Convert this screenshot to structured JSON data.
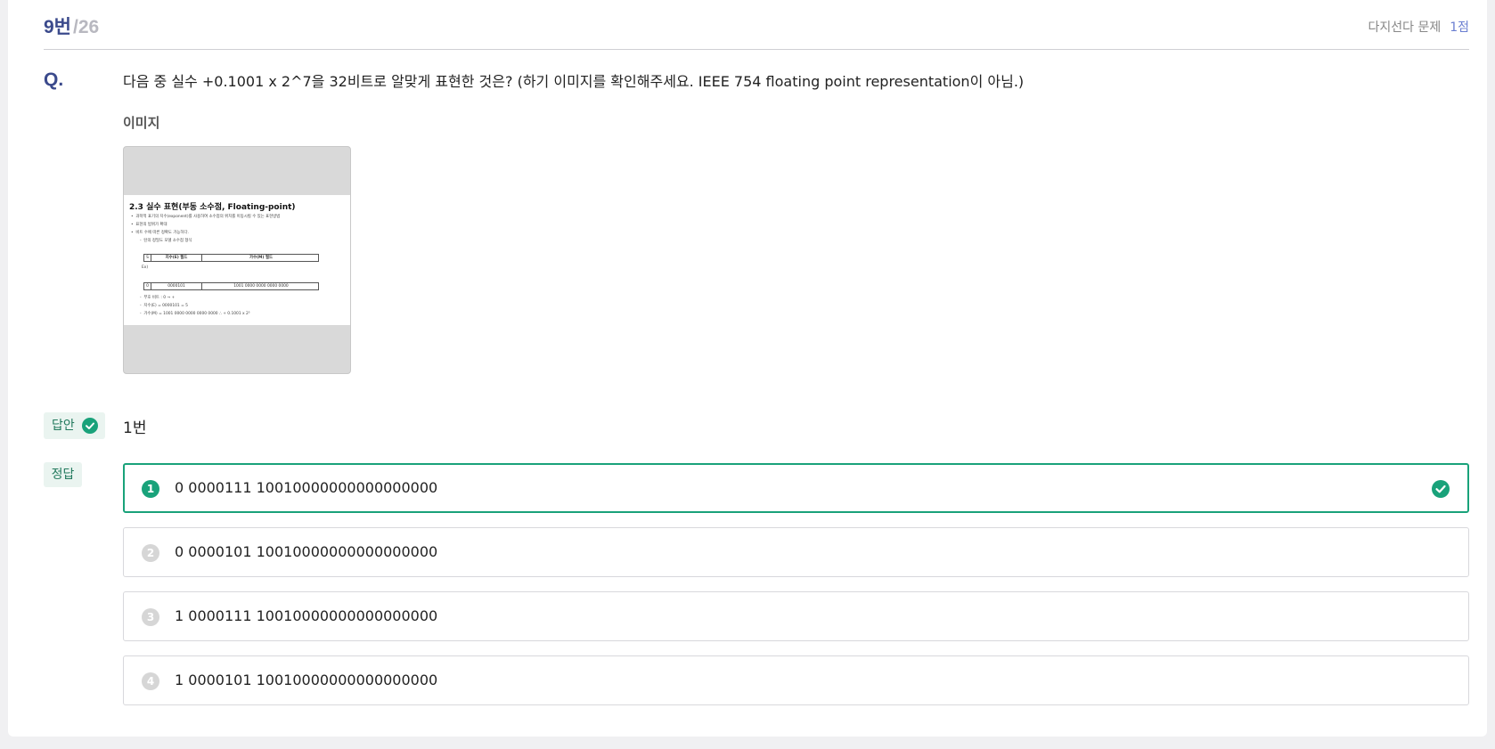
{
  "header": {
    "question_number": "9번",
    "total": "/26",
    "question_type": "다지선다 문제",
    "points": "1점"
  },
  "question": {
    "mark": "Q.",
    "text": "다음 중 실수 +0.1001 x 2^7을 32비트로 알맞게 표현한 것은? (하기 이미지를 확인해주세요. IEEE 754 floating point representation이 아님.)",
    "image_label": "이미지"
  },
  "slide": {
    "title": "2.3 실수 표현(부동 소수점, Floating-point)",
    "bullets": [
      "과학적 표기의 지수(exponent)를 사용하여 소수점의 위치를 이동시킬 수 있는 표현방법",
      "표현의 범위가 확대",
      "비트 수에 따른 정확도 가능하다."
    ],
    "sub": "탄의 정밀도 모델 소수점 형식",
    "field_row1": [
      "S",
      "지수(E) 필드",
      "가수(M) 필드"
    ],
    "example_label": "Ex)",
    "field_row2": [
      "0",
      "0000101",
      "1001 0000 0000 0000 0000"
    ],
    "notes": [
      "부호 비트 : 0  →  +",
      "지수(E) = 0000101 = 5",
      "가수(M) = 1001 0000 0000 0000 0000  ∴ + 0.1001 x 2⁵"
    ]
  },
  "answer": {
    "badge_label": "답안",
    "value": "1번"
  },
  "correct": {
    "badge_label": "정답"
  },
  "options": [
    {
      "num": "1",
      "text": "0 0000111 10010000000000000000"
    },
    {
      "num": "2",
      "text": "0 0000101 10010000000000000000"
    },
    {
      "num": "3",
      "text": "1 0000111 10010000000000000000"
    },
    {
      "num": "4",
      "text": "1 0000101 10010000000000000000"
    }
  ],
  "colors": {
    "accent_navy": "#3b4a8c",
    "correct_green": "#19a27a",
    "badge_bg": "#eaf4f0"
  }
}
